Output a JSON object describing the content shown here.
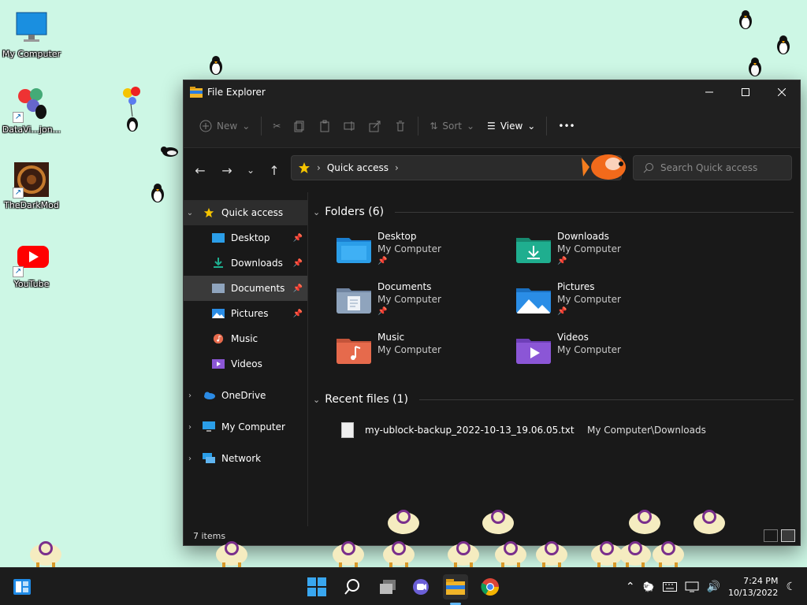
{
  "desktop": {
    "icons": [
      {
        "label": "My Computer"
      },
      {
        "label": "DataVi...jon..."
      },
      {
        "label": "TheDarkMod"
      },
      {
        "label": "YouTube"
      }
    ]
  },
  "window": {
    "title": "File Explorer",
    "toolbar": {
      "new_label": "New",
      "sort_label": "Sort",
      "view_label": "View",
      "more_label": "•••"
    },
    "address": {
      "location": "Quick access",
      "search_placeholder": "Search Quick access"
    },
    "nav": {
      "quick_access": "Quick access",
      "items": [
        {
          "label": "Desktop",
          "pinned": true
        },
        {
          "label": "Downloads",
          "pinned": true
        },
        {
          "label": "Documents",
          "pinned": true
        },
        {
          "label": "Pictures",
          "pinned": true
        },
        {
          "label": "Music",
          "pinned": false
        },
        {
          "label": "Videos",
          "pinned": false
        }
      ],
      "onedrive": "OneDrive",
      "my_computer": "My Computer",
      "network": "Network"
    },
    "folders_heading": "Folders (6)",
    "folders": [
      {
        "name": "Desktop",
        "location": "My Computer",
        "pinned": true,
        "color": "#2b9ee8"
      },
      {
        "name": "Downloads",
        "location": "My Computer",
        "pinned": true,
        "color": "#1fae8f"
      },
      {
        "name": "Documents",
        "location": "My Computer",
        "pinned": true,
        "color": "#8fa4bd"
      },
      {
        "name": "Pictures",
        "location": "My Computer",
        "pinned": true,
        "color": "#2a8de6"
      },
      {
        "name": "Music",
        "location": "My Computer",
        "pinned": false,
        "color": "#e66a4c"
      },
      {
        "name": "Videos",
        "location": "My Computer",
        "pinned": false,
        "color": "#8b56d6"
      }
    ],
    "recent_heading": "Recent files (1)",
    "recent": [
      {
        "name": "my-ublock-backup_2022-10-13_19.06.05.txt",
        "location": "My Computer\\Downloads"
      }
    ],
    "status": "7 items"
  },
  "taskbar": {
    "time": "7:24 PM",
    "date": "10/13/2022"
  },
  "colors": {
    "desktop_bg": "#cdf7e5",
    "window_bg": "#191919",
    "accent": "#0078d4"
  }
}
